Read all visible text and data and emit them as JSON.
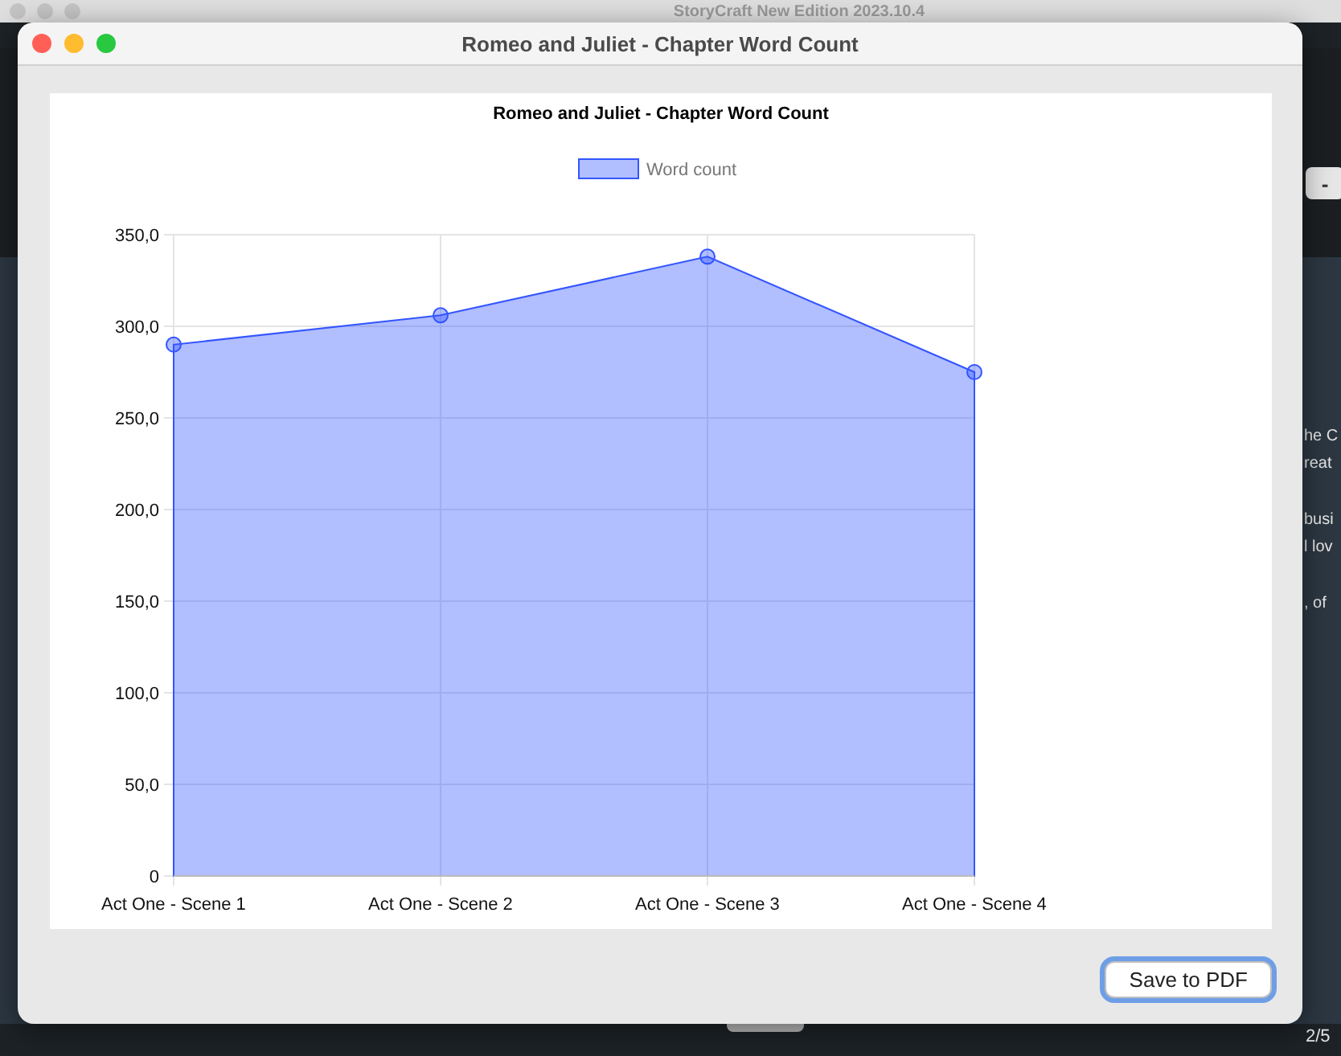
{
  "background_window": {
    "title": "StoryCraft New Edition 2023.10.4",
    "button": "-",
    "paragraph_fragments": [
      [
        "he C",
        "reat"
      ],
      [
        "busi",
        "l lov"
      ],
      [
        ", of"
      ]
    ],
    "page_indicator": "2/5"
  },
  "window": {
    "title": "Romeo and Juliet - Chapter Word Count"
  },
  "chart_data": {
    "type": "area",
    "title": "Romeo and Juliet - Chapter Word Count",
    "categories": [
      "Act One - Scene 1",
      "Act One - Scene 2",
      "Act One - Scene 3",
      "Act One - Scene 4"
    ],
    "series": [
      {
        "name": "Word count",
        "color": "#3355ff",
        "values": [
          290,
          306,
          338,
          275
        ]
      }
    ],
    "ylim": [
      0,
      350
    ],
    "grid": true,
    "yticks": [
      {
        "value": 0,
        "label": "0"
      },
      {
        "value": 50,
        "label": "50,0"
      },
      {
        "value": 100,
        "label": "100,0"
      },
      {
        "value": 150,
        "label": "150,0"
      },
      {
        "value": 200,
        "label": "200,0"
      },
      {
        "value": 250,
        "label": "250,0"
      },
      {
        "value": 300,
        "label": "300,0"
      },
      {
        "value": 350,
        "label": "350,0"
      }
    ]
  },
  "buttons": [
    {
      "label": "Save to PDF",
      "focused": true
    }
  ]
}
